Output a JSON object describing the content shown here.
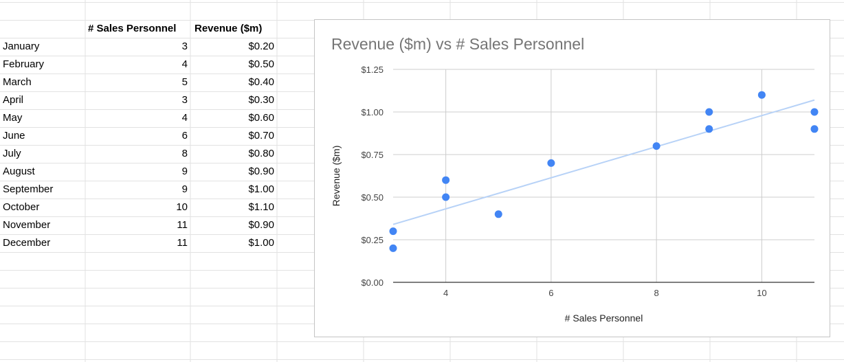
{
  "sheet": {
    "headers": [
      "",
      "# Sales Personnel",
      "Revenue ($m)"
    ],
    "rows": [
      [
        "January",
        "3",
        "$0.20"
      ],
      [
        "February",
        "4",
        "$0.50"
      ],
      [
        "March",
        "5",
        "$0.40"
      ],
      [
        "April",
        "3",
        "$0.30"
      ],
      [
        "May",
        "4",
        "$0.60"
      ],
      [
        "June",
        "6",
        "$0.70"
      ],
      [
        "July",
        "8",
        "$0.80"
      ],
      [
        "August",
        "9",
        "$0.90"
      ],
      [
        "September",
        "9",
        "$1.00"
      ],
      [
        "October",
        "10",
        "$1.10"
      ],
      [
        "November",
        "11",
        "$0.90"
      ],
      [
        "December",
        "11",
        "$1.00"
      ]
    ]
  },
  "chart_data": {
    "type": "scatter",
    "title": "Revenue ($m) vs # Sales Personnel",
    "xlabel": "# Sales Personnel",
    "ylabel": "Revenue ($m)",
    "x": [
      3,
      4,
      5,
      3,
      4,
      6,
      8,
      9,
      9,
      10,
      11,
      11
    ],
    "y": [
      0.2,
      0.5,
      0.4,
      0.3,
      0.6,
      0.7,
      0.8,
      0.9,
      1.0,
      1.1,
      0.9,
      1.0
    ],
    "xlim": [
      3,
      11
    ],
    "ylim": [
      0,
      1.25
    ],
    "xticks": [
      4,
      6,
      8,
      10
    ],
    "yticks": [
      0,
      0.25,
      0.5,
      0.75,
      1.0,
      1.25
    ],
    "ytick_labels": [
      "$0.00",
      "$0.25",
      "$0.50",
      "$0.75",
      "$1.00",
      "$1.25"
    ],
    "trendline": {
      "type": "linear",
      "from": [
        3,
        0.34
      ],
      "to": [
        11,
        1.07
      ]
    },
    "grid": true,
    "legend": "none",
    "point_color": "#4285f4",
    "trendline_color": "#b7d2f7"
  }
}
